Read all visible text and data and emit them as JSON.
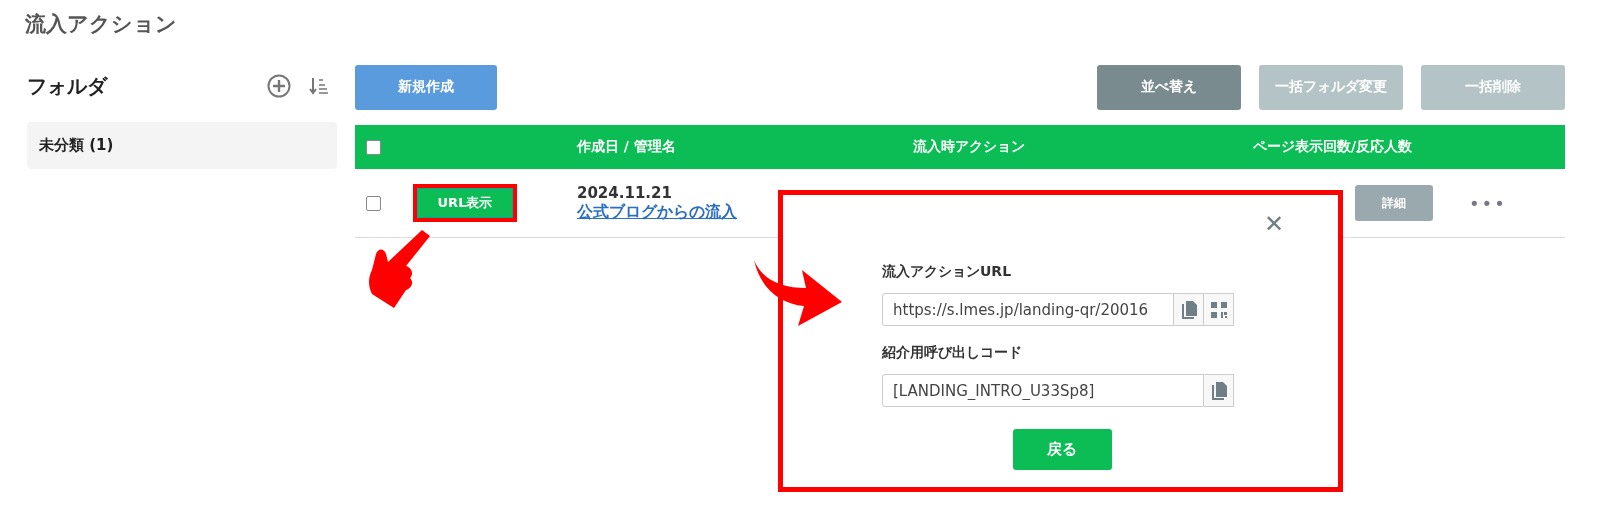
{
  "page_title": "流入アクション",
  "sidebar": {
    "title": "フォルダ",
    "items": [
      {
        "label": "未分類 (1)",
        "selected": true
      }
    ]
  },
  "toolbar": {
    "create": "新規作成",
    "buttons": [
      {
        "label": "並べ替え",
        "disabled": false
      },
      {
        "label": "一括フォルダ変更",
        "disabled": true
      },
      {
        "label": "一括削除",
        "disabled": true
      }
    ]
  },
  "table": {
    "header_checked": false,
    "columns": [
      "作成日 / 管理名",
      "流入時アクション",
      "ページ表示回数/反応人数"
    ],
    "rows": [
      {
        "checked": false,
        "url_button": "URL表示",
        "date": "2024.11.21",
        "name": "公式ブログからの流入",
        "detail": "詳細",
        "more": "•••"
      }
    ]
  },
  "modal": {
    "close": "✕",
    "fields": [
      {
        "label": "流入アクションURL",
        "value": "https://s.lmes.jp/landing-qr/20016",
        "qr": true
      },
      {
        "label": "紹介用呼び出しコード",
        "value": "[LANDING_INTRO_U33Sp8]",
        "qr": false
      }
    ],
    "back": "戻る"
  }
}
